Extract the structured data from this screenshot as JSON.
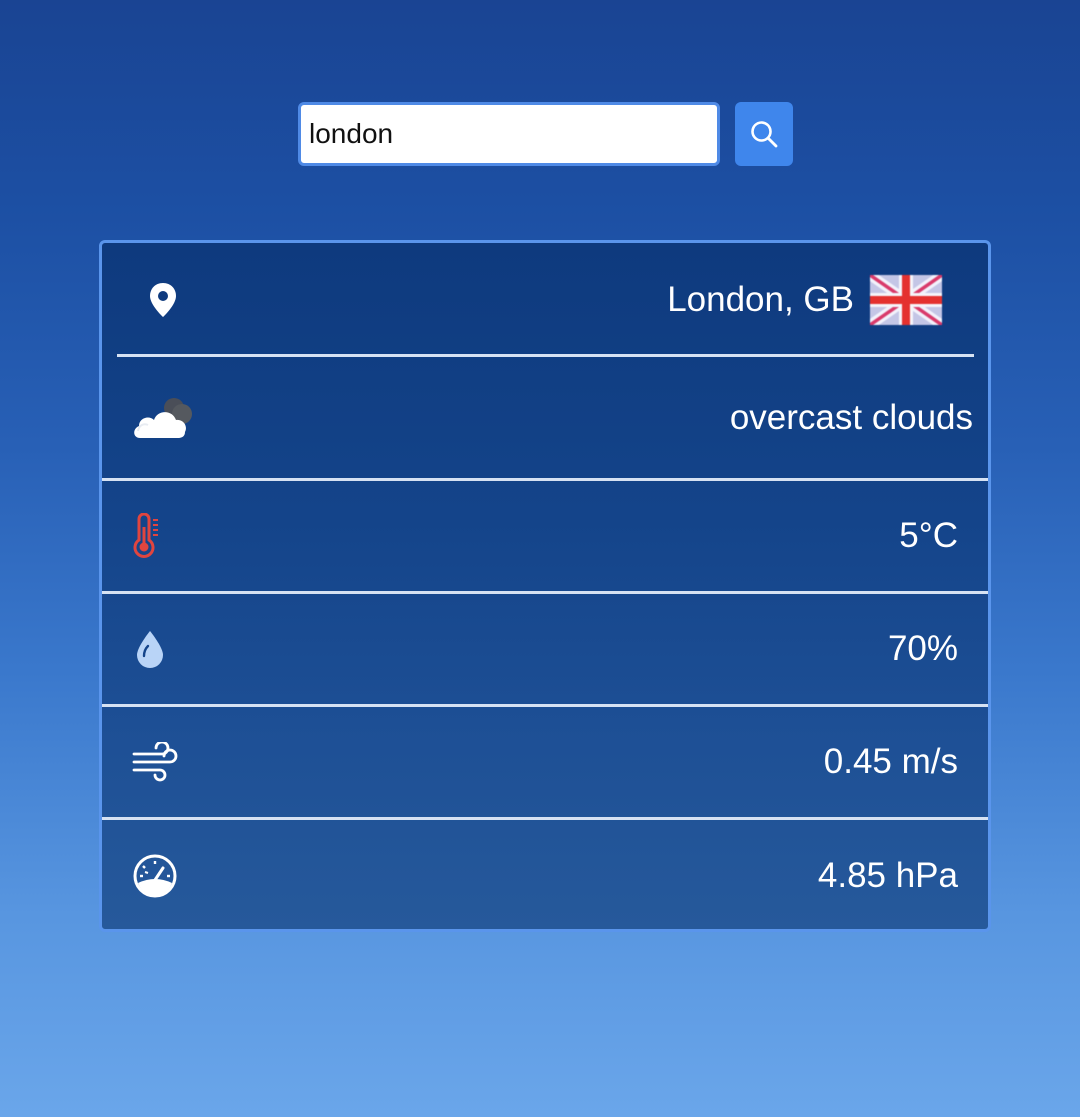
{
  "search": {
    "value": "london",
    "button_icon": "search-icon"
  },
  "weather": {
    "location": "London, GB",
    "location_icon": "location-pin-icon",
    "flag_icon": "uk-flag-icon",
    "description": "overcast clouds",
    "description_icon": "overcast-clouds-icon",
    "temperature": "5°C",
    "temperature_icon": "thermometer-icon",
    "humidity": "70%",
    "humidity_icon": "water-drop-icon",
    "wind": "0.45 m/s",
    "wind_icon": "wind-icon",
    "pressure": "4.85 hPa",
    "pressure_icon": "gauge-icon"
  },
  "colors": {
    "accent": "#3f86ec",
    "card_border": "#5a95ec",
    "thermometer": "#e0453f",
    "drop": "#b9d4f7"
  }
}
